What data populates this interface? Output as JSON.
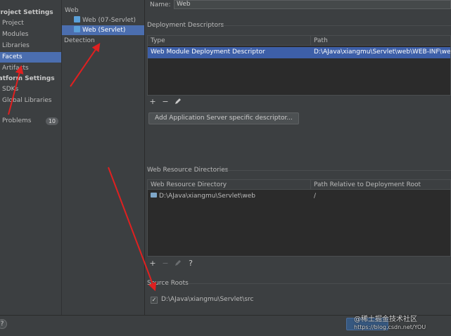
{
  "left_nav": {
    "project_settings_header": "Project Settings",
    "project_items": [
      "Project",
      "Modules",
      "Libraries",
      "Facets",
      "Artifacts"
    ],
    "selected_item": "Facets",
    "platform_settings_header": "Platform Settings",
    "platform_items": [
      "SDKs",
      "Global Libraries"
    ],
    "problems_label": "Problems",
    "problems_count": "10"
  },
  "facet_tree": {
    "group_label": "Web",
    "items": [
      "Web (07-Servlet)",
      "Web (Servlet)"
    ],
    "selected_item": "Web (Servlet)",
    "detection_label": "Detection"
  },
  "facet": {
    "name_label": "Name:",
    "name_value": "Web"
  },
  "deployment_descriptors": {
    "title": "Deployment Descriptors",
    "columns": [
      "Type",
      "Path"
    ],
    "rows": [
      {
        "type": "Web Module Deployment Descriptor",
        "path": "D:\\AJava\\xiangmu\\Servlet\\web\\WEB-INF\\web.xml"
      }
    ],
    "add_server_descriptor_button": "Add Application Server specific descriptor..."
  },
  "web_resource_directories": {
    "title": "Web Resource Directories",
    "columns": [
      "Web Resource Directory",
      "Path Relative to Deployment Root"
    ],
    "rows": [
      {
        "directory": "D:\\AJava\\xiangmu\\Servlet\\web",
        "relative": "/"
      }
    ]
  },
  "source_roots": {
    "title": "Source Roots",
    "items": [
      {
        "path": "D:\\AJava\\xiangmu\\Servlet\\src",
        "checked": true
      }
    ]
  },
  "toolbar": {
    "add_symbol": "+",
    "remove_symbol": "−",
    "help_symbol": "?"
  },
  "watermark": {
    "line1": "@稀土掘金技术社区",
    "line2": "https://blog.csdn.net/YOU"
  },
  "colors": {
    "selection": "#4b6eaf",
    "arrow": "#e02020"
  }
}
